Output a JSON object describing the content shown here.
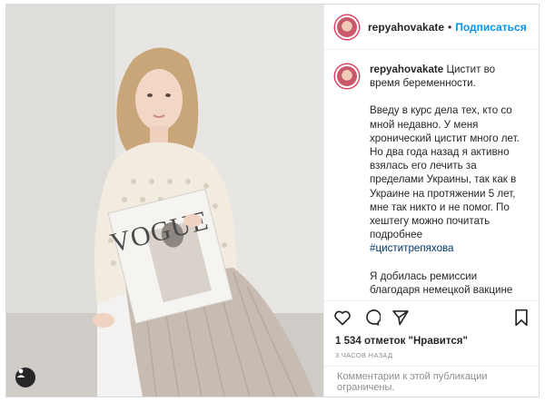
{
  "post": {
    "username": "repyahovakate",
    "separator": "•",
    "follow_label": "Подписаться",
    "caption_first": "Цистит во время беременности.",
    "paragraph1": "Введу в курс дела тех, кто со мной недавно. У меня хронический цистит много лет. Но два года назад я активно взялась его лечить за пределами Украины, так как в Украине на протяжении 5 лет, мне так никто и не помог. По хештегу можно почитать подробнее",
    "hashtag": "#циститрепяхова",
    "paragraph2": "Я добилась ремиссии благодаря немецкой вакцине «стровак», которую делала каждые пол года по рекомендации немецкого врача-уролога. В октябре подходило время делать очередную прививку, но в сентябре я забеременела.",
    "likes": "1 534 отметок \"Нравится\"",
    "time": "3 ЧАСОВ НАЗАД",
    "comments_disabled": "Комментарии к этой публикации ограничены.",
    "magazine_text": "VOGUE",
    "icons": {
      "like": "heart-icon",
      "comment": "comment-icon",
      "share": "share-icon",
      "save": "bookmark-icon",
      "tag": "user-tag-icon"
    },
    "colors": {
      "accent": "#0095f6",
      "hashtag": "#00376b",
      "muted": "#8e8e8e"
    }
  }
}
